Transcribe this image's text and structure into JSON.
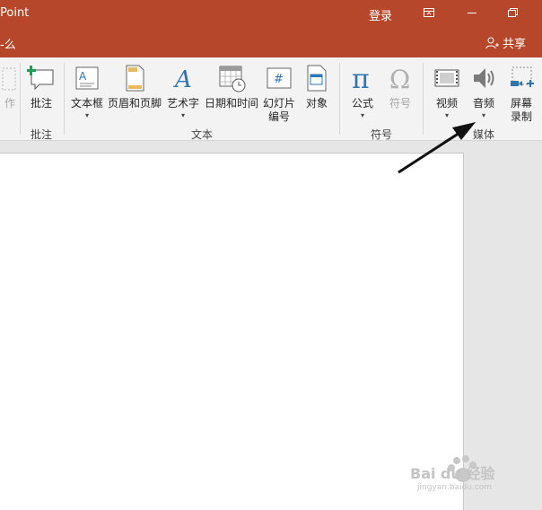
{
  "titlebar": {
    "app_title": "Point",
    "login": "登录"
  },
  "subbar": {
    "tell_me": "-么",
    "share": "共享"
  },
  "ribbon": {
    "partial_left_label": "作",
    "groups": {
      "comments": "批注",
      "text": "文本",
      "symbols": "符号",
      "media": "媒体"
    },
    "buttons": {
      "comment": "批注",
      "textbox": "文本框",
      "header_footer": "页眉和页脚",
      "wordart": "艺术字",
      "date_time": "日期和时间",
      "slide_number": "幻灯片\n编号",
      "object": "对象",
      "equation": "公式",
      "symbol": "符号",
      "video": "视频",
      "audio": "音频",
      "screen_recording": "屏幕\n录制"
    }
  },
  "watermark": {
    "brand": "Bai du 经验",
    "url": "jingyan.baidu.com"
  },
  "colors": {
    "titlebar": "#b7472a",
    "ribbon": "#f3f3f3",
    "accent_blue": "#2e75b6"
  }
}
